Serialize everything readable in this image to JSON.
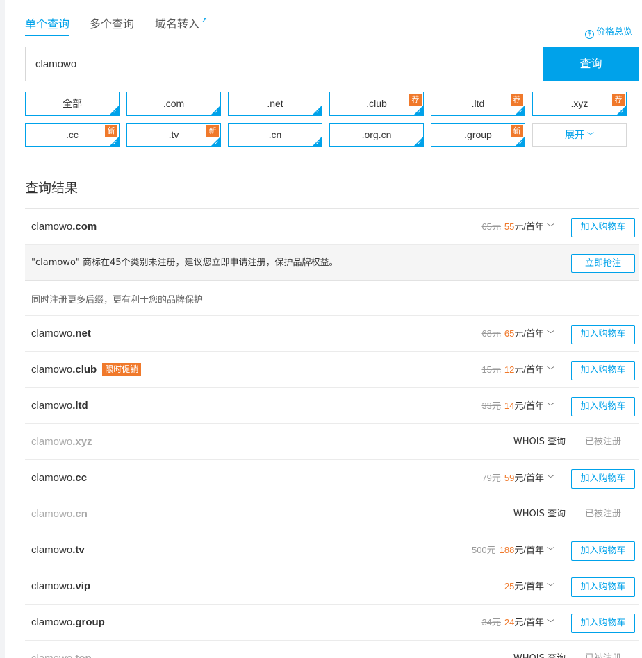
{
  "tabs": {
    "single": "单个查询",
    "multi": "多个查询",
    "transfer": "域名转入",
    "transfer_icon": "external-link-icon"
  },
  "overview": {
    "label": "价格总览",
    "icon": "coin-icon"
  },
  "search": {
    "value": "clamowo",
    "button": "查询"
  },
  "chips": [
    {
      "label": "全部",
      "tag": ""
    },
    {
      "label": ".com",
      "tag": ""
    },
    {
      "label": ".net",
      "tag": ""
    },
    {
      "label": ".club",
      "tag": "荐"
    },
    {
      "label": ".ltd",
      "tag": "荐"
    },
    {
      "label": ".xyz",
      "tag": "荐"
    },
    {
      "label": ".cc",
      "tag": "新"
    },
    {
      "label": ".tv",
      "tag": "新"
    },
    {
      "label": ".cn",
      "tag": ""
    },
    {
      "label": ".org.cn",
      "tag": ""
    },
    {
      "label": ".group",
      "tag": "新"
    }
  ],
  "expand": {
    "label": "展开",
    "caret": "﹀"
  },
  "results_title": "查询结果",
  "colors": {
    "accent": "#00a2ea",
    "promo": "#f0792b"
  },
  "first": {
    "name": "clamowo",
    "tld": ".com",
    "old": "65元",
    "new": "55",
    "unit": "元/首年",
    "button": "加入购物车"
  },
  "trademark": {
    "text": "\"clamowo\" 商标在45个类别未注册，建议您立即申请注册，保护品牌权益。",
    "button": "立即抢注"
  },
  "hint": "同时注册更多后缀，更有利于您的品牌保护",
  "rows": [
    {
      "name": "clamowo",
      "tld": ".net",
      "promo": "",
      "old": "68元",
      "new": "65",
      "unit": "元/首年",
      "button": "加入购物车"
    },
    {
      "name": "clamowo",
      "tld": ".club",
      "promo": "限时促销",
      "old": "15元",
      "new": "12",
      "unit": "元/首年",
      "button": "加入购物车"
    },
    {
      "name": "clamowo",
      "tld": ".ltd",
      "promo": "",
      "old": "33元",
      "new": "14",
      "unit": "元/首年",
      "button": "加入购物车"
    },
    {
      "name": "clamowo",
      "tld": ".xyz",
      "whois": "WHOIS 查询",
      "status": "已被注册"
    },
    {
      "name": "clamowo",
      "tld": ".cc",
      "promo": "",
      "old": "79元",
      "new": "59",
      "unit": "元/首年",
      "button": "加入购物车"
    },
    {
      "name": "clamowo",
      "tld": ".cn",
      "whois": "WHOIS 查询",
      "status": "已被注册"
    },
    {
      "name": "clamowo",
      "tld": ".tv",
      "promo": "",
      "old": "500元",
      "new": "188",
      "unit": "元/首年",
      "button": "加入购物车"
    },
    {
      "name": "clamowo",
      "tld": ".vip",
      "promo": "",
      "old": "",
      "new": "25",
      "unit": "元/首年",
      "button": "加入购物车"
    },
    {
      "name": "clamowo",
      "tld": ".group",
      "promo": "",
      "old": "34元",
      "new": "24",
      "unit": "元/首年",
      "button": "加入购物车"
    },
    {
      "name": "clamowo",
      "tld": ".top",
      "whois": "WHOIS 查询",
      "status": "已被注册"
    }
  ]
}
